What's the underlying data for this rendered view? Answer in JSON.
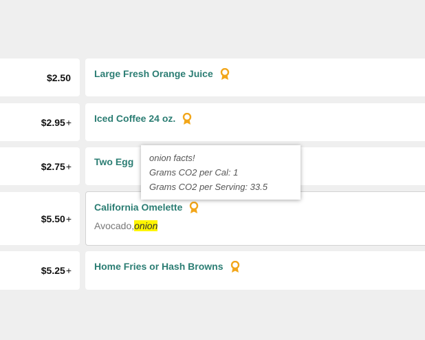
{
  "menu_items": [
    {
      "price": "$2.50",
      "plus": "",
      "name": "Large Fresh Orange Juice",
      "award_icon": "award-ribbon-icon"
    },
    {
      "price": "$2.95",
      "plus": "+",
      "name": "Iced Coffee 24 oz.",
      "award_icon": "award-ribbon-icon"
    },
    {
      "price": "$2.75",
      "plus": "+",
      "name": "Two Egg"
    },
    {
      "price": "$5.50",
      "plus": "+",
      "name": "California Omelette",
      "award_icon": "award-ribbon-icon",
      "ingredients_prefix": "Avocado,",
      "ingredients_highlight": "onion"
    },
    {
      "price": "$5.25",
      "plus": "+",
      "name": "Home Fries or Hash Browns",
      "award_icon": "award-ribbon-icon"
    }
  ],
  "tooltip": {
    "title": "onion facts!",
    "line1": "Grams CO2 per Cal: 1",
    "line2": "Grams CO2 per Serving: 33.5"
  },
  "colors": {
    "background": "#efefef",
    "item_name": "#2b7d73",
    "award": "#f2a61a",
    "highlight": "#fff500"
  }
}
